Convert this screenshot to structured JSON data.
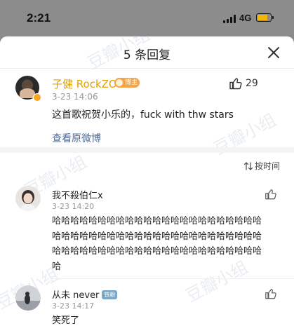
{
  "status_bar": {
    "time": "2:21",
    "network": "4G",
    "battery_level": 0.85,
    "battery_color": "#f2b705"
  },
  "sheet": {
    "title": "5 条回复"
  },
  "main_comment": {
    "username": "子健 RockZO",
    "badge": "博主",
    "time": "3-23 14:06",
    "like_count": "29",
    "text": "这首歌祝贺小乐的，fuck with thw stars",
    "view_original": "查看原微博",
    "name_color": "#e0a200"
  },
  "sort": {
    "label": "按时间"
  },
  "replies": [
    {
      "username": "我不殺伯仁x",
      "time": "3-23 14:20",
      "text": "哈哈哈哈哈哈哈哈哈哈哈哈哈哈哈哈哈哈哈哈哈哈哈哈哈哈哈哈哈哈哈哈哈哈哈哈哈哈哈哈哈哈哈哈哈哈哈哈哈哈哈哈哈哈哈哈哈哈哈哈哈哈哈哈哈哈哈哈哈哈"
    },
    {
      "username": "从未 never",
      "badge": "铁粉",
      "time": "3-23 14:17",
      "text": "笑死了"
    }
  ],
  "icons": {
    "close": "close-icon",
    "like": "thumbs-up-icon",
    "sort": "sort-icon",
    "verified": "verified-badge-icon"
  },
  "watermark": "豆瓣小组"
}
